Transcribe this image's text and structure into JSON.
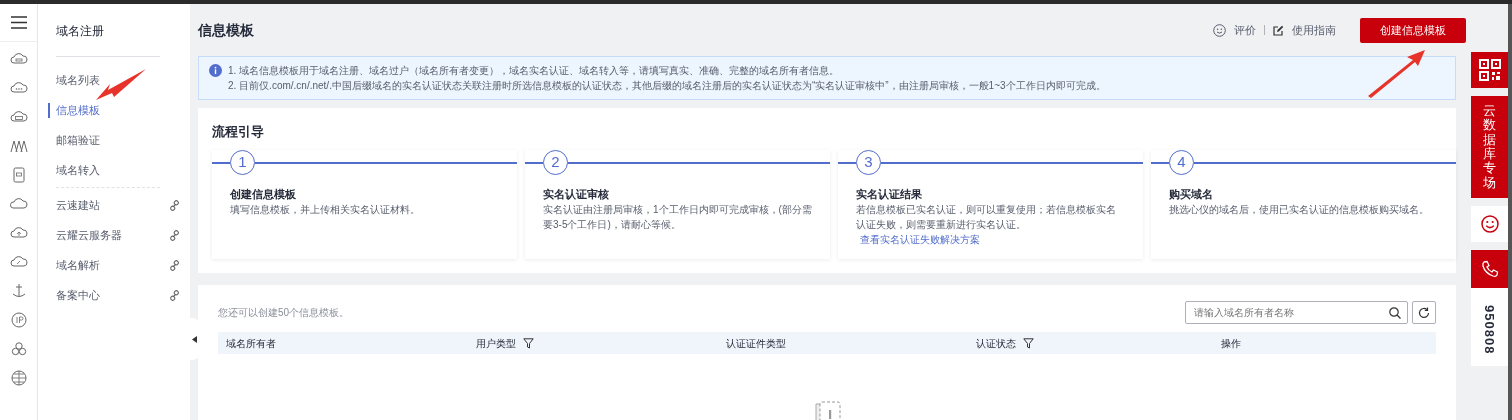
{
  "sidebar": {
    "title": "域名注册",
    "groups": [
      [
        {
          "label": "域名列表",
          "selected": false,
          "external": false
        },
        {
          "label": "信息模板",
          "selected": true,
          "external": false
        },
        {
          "label": "邮箱验证",
          "selected": false,
          "external": false
        },
        {
          "label": "域名转入",
          "selected": false,
          "external": false
        }
      ],
      [
        {
          "label": "云速建站",
          "selected": false,
          "external": true
        },
        {
          "label": "云耀云服务器",
          "selected": false,
          "external": true
        },
        {
          "label": "域名解析",
          "selected": false,
          "external": true
        },
        {
          "label": "备案中心",
          "selected": false,
          "external": true
        }
      ]
    ]
  },
  "header": {
    "title": "信息模板",
    "feedback": "评价",
    "guide": "使用指南",
    "create_button": "创建信息模板"
  },
  "notice": [
    "1. 域名信息模板用于域名注册、域名过户（域名所有者变更），域名实名认证、域名转入等，请填写真实、准确、完整的域名所有者信息。",
    "2. 目前仅.com/.cn/.net/.中国后缀域名的实名认证状态关联注册时所选信息模板的认证状态，其他后缀的域名注册后的实名认证状态为“实名认证审核中”，由注册局审核，一般1~3个工作日内即可完成。"
  ],
  "flow": {
    "title": "流程引导",
    "steps": [
      {
        "number": "1",
        "title": "创建信息模板",
        "description": "填写信息模板，并上传相关实名认证材料。"
      },
      {
        "number": "2",
        "title": "实名认证审核",
        "description": "实名认证由注册局审核，1个工作日内即可完成审核，(部分需要3-5个工作日)，请耐心等候。"
      },
      {
        "number": "3",
        "title": "实名认证结果",
        "description": "若信息模板已实名认证，则可以重复使用；若信息模板实名认证失败，则需要重新进行实名认证。",
        "link": "查看实名认证失败解决方案"
      },
      {
        "number": "4",
        "title": "购买域名",
        "description": "挑选心仪的域名后，使用已实名认证的信息模板购买域名。"
      }
    ]
  },
  "templates": {
    "quota_text": "您还可以创建50个信息模板。",
    "search": {
      "placeholder": "请输入域名所有者名称"
    },
    "columns": [
      {
        "label": "域名所有者",
        "filter": false
      },
      {
        "label": "用户类型",
        "filter": true
      },
      {
        "label": "认证证件类型",
        "filter": false
      },
      {
        "label": "认证状态",
        "filter": true
      },
      {
        "label": "操作",
        "filter": false
      }
    ]
  },
  "float_bar": {
    "promo": "云数据库专场",
    "phone": "950808"
  }
}
